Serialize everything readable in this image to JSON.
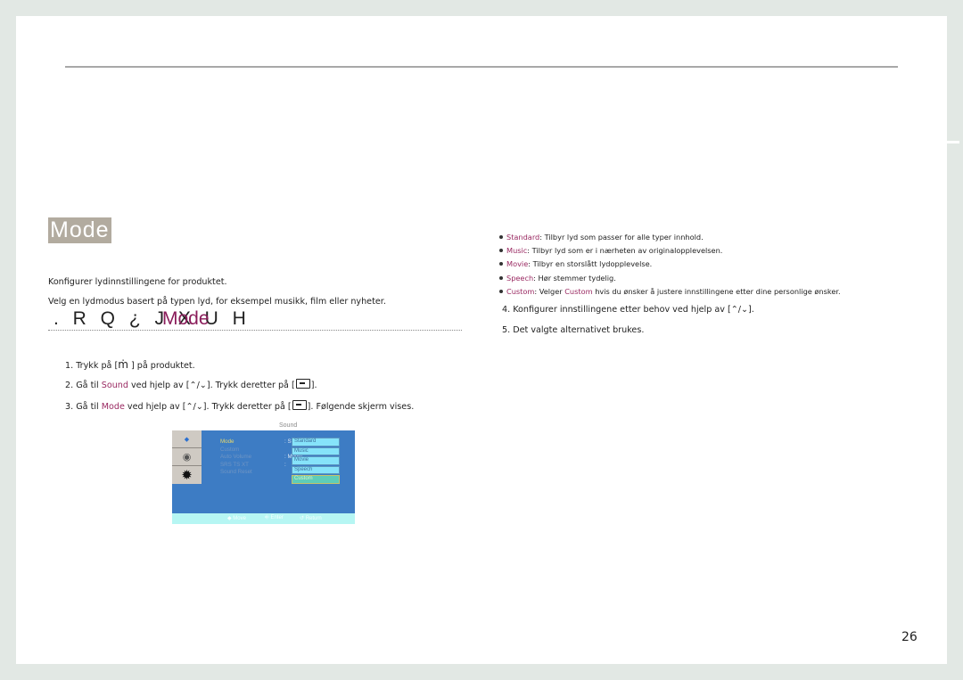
{
  "section_title": "Mode",
  "intro": [
    "Konfigurer lydinnstillingene for produktet.",
    "Velg en lydmodus basert på typen lyd, for eksempel musikk, film eller nyheter."
  ],
  "heading": {
    "garbled": ". R Q ¿ J X U H",
    "overlay": "Mode"
  },
  "steps_left": [
    {
      "num": "1.",
      "pre": "Trykk på [",
      "icon": "menu-button-icon",
      "icon_glyph": "ṁ",
      "post": " ] på produktet."
    },
    {
      "num": "2.",
      "pre": "Gå til ",
      "highlight": "Sound",
      "mid": " ved hjelp av [",
      "arrows": "⌃/⌄",
      "mid2": "]. Trykk deretter på [",
      "post": "]."
    },
    {
      "num": "3.",
      "pre": "Gå til ",
      "highlight": "Mode",
      "mid": " ved hjelp av [",
      "arrows": "⌃/⌄",
      "mid2": "]. Trykk deretter på [",
      "post": "]. Følgende skjerm vises."
    }
  ],
  "osd": {
    "title": "Sound",
    "menu": [
      "Mode",
      "Custom",
      "Auto Volume",
      "SRS TS XT",
      "Sound Reset"
    ],
    "values": [
      ": Standard",
      "",
      ": Movie",
      ":",
      ""
    ],
    "options": [
      "Standard",
      "Music",
      "Movie",
      "Speech",
      "Custom"
    ],
    "selected_option": "Custom",
    "footer": {
      "move": "◆ Move",
      "enter": "⎆ Enter",
      "return": "↺ Return"
    }
  },
  "bullets": [
    {
      "term": "Standard",
      "text": ": Tilbyr lyd som passer for alle typer innhold."
    },
    {
      "term": "Music",
      "text": ": Tilbyr lyd som er i nærheten av originalopplevelsen."
    },
    {
      "term": "Movie",
      "text": ": Tilbyr en storslått lydopplevelse."
    },
    {
      "term": "Speech",
      "text": ": Hør stemmer tydelig."
    },
    {
      "term": "Custom",
      "text": ": Velger ",
      "term2": "Custom",
      "text2": " hvis du ønsker å justere innstillingene etter dine personlige ønsker."
    }
  ],
  "steps_right": [
    {
      "num": "4.",
      "pre": "Konfigurer innstillingene etter behov ved hjelp av [",
      "arrows": "⌃/⌄",
      "post": "]."
    },
    {
      "num": "5.",
      "pre": "Det valgte alternativet brukes."
    }
  ],
  "page_number": "26",
  "colors": {
    "highlight": "#9a2a62",
    "title_bg": "#b2ab9f",
    "osd_blue": "#3d7cc4",
    "background": "#e2e8e4"
  }
}
